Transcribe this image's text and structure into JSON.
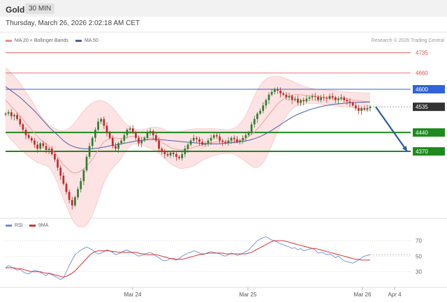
{
  "header": {
    "symbol": "Gold",
    "timeframe": "30 MIN"
  },
  "subheader": {
    "datetime": "Thursday, March 26, 2026 2:02:18 AM CET"
  },
  "legend": {
    "ma20_label": "MA 20 + Bollinger Bands",
    "ma50_label": "MA 50",
    "credit": "Research © 2026 Trading Central"
  },
  "rsi_legend": {
    "rsi_label": "RSI",
    "ma_label": "9MA"
  },
  "colors": {
    "up_candle": "#2e7d32",
    "down_candle": "#c62828",
    "bollinger_fill": "#fde3e3",
    "ma20": "#f0a0a0",
    "ma50": "#4a5fa8",
    "resistance": "#e04a4a",
    "pivot_blue": "#2f63d6",
    "support_green": "#1e8a1e",
    "last_price": "#333333",
    "arrow": "#2a5aa0",
    "rsi_line": "#6b8fd6",
    "rsi_ma": "#d83030"
  },
  "chart_data": [
    {
      "type": "candlestick",
      "title": "Gold 30 MIN",
      "x_ticks": [
        "Mar 24",
        "Mar 25",
        "Mar 26",
        "Apr 4"
      ],
      "ylim": [
        4130,
        4760
      ],
      "levels": [
        {
          "value": 4735,
          "label": "4735",
          "kind": "resistance"
        },
        {
          "value": 4660,
          "label": "4660",
          "kind": "resistance"
        },
        {
          "value": 4600,
          "label": "4600",
          "kind": "pivot"
        },
        {
          "value": 4535,
          "label": "4535",
          "kind": "last_price"
        },
        {
          "value": 4440,
          "label": "4440",
          "kind": "support"
        },
        {
          "value": 4370,
          "label": "4370",
          "kind": "support"
        }
      ],
      "projection": {
        "from": 4535,
        "to": 4370
      },
      "close": [
        4510,
        4515,
        4500,
        4505,
        4490,
        4470,
        4450,
        4430,
        4420,
        4410,
        4395,
        4380,
        4400,
        4390,
        4375,
        4380,
        4360,
        4340,
        4310,
        4280,
        4250,
        4220,
        4190,
        4170,
        4200,
        4230,
        4260,
        4300,
        4350,
        4390,
        4420,
        4450,
        4480,
        4490,
        4465,
        4440,
        4420,
        4390,
        4380,
        4400,
        4410,
        4430,
        4450,
        4455,
        4440,
        4420,
        4400,
        4410,
        4420,
        4440,
        4445,
        4430,
        4410,
        4380,
        4370,
        4360,
        4355,
        4365,
        4360,
        4350,
        4345,
        4360,
        4380,
        4395,
        4410,
        4420,
        4415,
        4405,
        4395,
        4400,
        4410,
        4420,
        4430,
        4425,
        4410,
        4405,
        4400,
        4410,
        4420,
        4415,
        4405,
        4410,
        4420,
        4430,
        4440,
        4470,
        4490,
        4510,
        4520,
        4540,
        4560,
        4580,
        4590,
        4600,
        4595,
        4585,
        4580,
        4570,
        4575,
        4560,
        4565,
        4550,
        4560,
        4555,
        4565,
        4570,
        4575,
        4572,
        4560,
        4570,
        4568,
        4565,
        4575,
        4570,
        4560,
        4565,
        4570,
        4560,
        4555,
        4550,
        4540,
        4530,
        4520,
        4530,
        4525,
        4530,
        4535
      ],
      "ma20": [
        4560,
        4548,
        4536,
        4525,
        4513,
        4500,
        4488,
        4475,
        4463,
        4450,
        4438,
        4425,
        4415,
        4405,
        4398,
        4390,
        4378,
        4365,
        4350,
        4335,
        4320,
        4310,
        4300,
        4292,
        4290,
        4292,
        4298,
        4305,
        4315,
        4328,
        4342,
        4358,
        4375,
        4392,
        4405,
        4412,
        4418,
        4420,
        4420,
        4418,
        4418,
        4420,
        4422,
        4425,
        4426,
        4425,
        4423,
        4422,
        4421,
        4420,
        4420,
        4418,
        4415,
        4410,
        4404,
        4397,
        4390,
        4384,
        4380,
        4378,
        4376,
        4376,
        4378,
        4380,
        4382,
        4385,
        4388,
        4392,
        4395,
        4398,
        4400,
        4402,
        4404,
        4405,
        4406,
        4406,
        4406,
        4406,
        4407,
        4408,
        4408,
        4410,
        4413,
        4418,
        4425,
        4433,
        4442,
        4453,
        4465,
        4478,
        4492,
        4506,
        4520,
        4533,
        4545,
        4555,
        4563,
        4570,
        4575,
        4578,
        4580,
        4580,
        4580,
        4578,
        4577,
        4576,
        4575,
        4574,
        4573,
        4572,
        4570,
        4569,
        4568,
        4567,
        4566,
        4565,
        4564,
        4563,
        4562,
        4561,
        4560,
        4558,
        4557,
        4556,
        4555,
        4554,
        4553
      ],
      "ma50": [
        4610,
        4602,
        4594,
        4586,
        4578,
        4570,
        4560,
        4550,
        4540,
        4530,
        4520,
        4508,
        4496,
        4484,
        4472,
        4460,
        4450,
        4440,
        4430,
        4420,
        4410,
        4402,
        4395,
        4390,
        4386,
        4383,
        4381,
        4380,
        4380,
        4380,
        4380,
        4381,
        4382,
        4384,
        4386,
        4388,
        4390,
        4392,
        4394,
        4396,
        4398,
        4400,
        4402,
        4404,
        4406,
        4408,
        4410,
        4411,
        4412,
        4413,
        4414,
        4414,
        4414,
        4414,
        4413,
        4412,
        4411,
        4410,
        4409,
        4408,
        4407,
        4406,
        4405,
        4404,
        4403,
        4402,
        4401,
        4400,
        4399,
        4398,
        4398,
        4398,
        4398,
        4398,
        4398,
        4399,
        4400,
        4401,
        4402,
        4403,
        4404,
        4405,
        4407,
        4409,
        4411,
        4414,
        4417,
        4421,
        4425,
        4430,
        4436,
        4442,
        4448,
        4455,
        4462,
        4469,
        4476,
        4483,
        4490,
        4496,
        4502,
        4507,
        4512,
        4516,
        4520,
        4524,
        4527,
        4530,
        4533,
        4536,
        4538,
        4540,
        4542,
        4544,
        4545,
        4546,
        4547,
        4548,
        4549,
        4550,
        4550,
        4551,
        4551,
        4552,
        4552,
        4553,
        4553
      ],
      "bb_upper": [
        4680,
        4670,
        4660,
        4648,
        4636,
        4622,
        4606,
        4590,
        4574,
        4558,
        4540,
        4522,
        4505,
        4490,
        4478,
        4468,
        4460,
        4455,
        4450,
        4447,
        4447,
        4450,
        4456,
        4465,
        4478,
        4492,
        4506,
        4520,
        4532,
        4542,
        4550,
        4555,
        4558,
        4558,
        4555,
        4550,
        4542,
        4532,
        4520,
        4506,
        4492,
        4478,
        4468,
        4460,
        4455,
        4452,
        4450,
        4450,
        4452,
        4455,
        4458,
        4460,
        4460,
        4458,
        4455,
        4450,
        4446,
        4444,
        4443,
        4443,
        4444,
        4446,
        4448,
        4450,
        4452,
        4453,
        4454,
        4454,
        4454,
        4454,
        4454,
        4454,
        4454,
        4453,
        4452,
        4451,
        4450,
        4450,
        4452,
        4456,
        4462,
        4472,
        4486,
        4504,
        4526,
        4550,
        4574,
        4596,
        4614,
        4628,
        4638,
        4644,
        4647,
        4648,
        4648,
        4646,
        4643,
        4639,
        4635,
        4630,
        4625,
        4620,
        4615,
        4611,
        4608,
        4605,
        4603,
        4601,
        4600,
        4599,
        4598,
        4597,
        4596,
        4595,
        4594,
        4593,
        4592,
        4591,
        4590,
        4589,
        4588,
        4588,
        4587,
        4587,
        4586,
        4586,
        4586
      ],
      "bb_lower": [
        4440,
        4426,
        4412,
        4402,
        4390,
        4378,
        4370,
        4360,
        4352,
        4342,
        4336,
        4328,
        4325,
        4320,
        4318,
        4312,
        4296,
        4275,
        4250,
        4223,
        4193,
        4170,
        4144,
        4119,
        4102,
        4092,
        4090,
        4090,
        4098,
        4114,
        4134,
        4161,
        4192,
        4226,
        4255,
        4274,
        4294,
        4308,
        4320,
        4330,
        4344,
        4362,
        4376,
        4390,
        4397,
        4398,
        4396,
        4394,
        4390,
        4385,
        4382,
        4376,
        4370,
        4362,
        4353,
        4344,
        4334,
        4324,
        4317,
        4313,
        4308,
        4306,
        4308,
        4310,
        4312,
        4317,
        4322,
        4330,
        4336,
        4342,
        4346,
        4350,
        4354,
        4357,
        4360,
        4361,
        4362,
        4362,
        4362,
        4360,
        4354,
        4348,
        4340,
        4332,
        4324,
        4316,
        4310,
        4310,
        4316,
        4328,
        4346,
        4368,
        4393,
        4418,
        4442,
        4464,
        4483,
        4501,
        4515,
        4526,
        4535,
        4540,
        4545,
        4545,
        4546,
        4547,
        4547,
        4547,
        4546,
        4545,
        4542,
        4541,
        4540,
        4539,
        4538,
        4537,
        4536,
        4535,
        4534,
        4533,
        4532,
        4528,
        4527,
        4525,
        4524,
        4522,
        4520
      ]
    },
    {
      "type": "line",
      "title": "RSI",
      "y_ticks": [
        30,
        50,
        70
      ],
      "ylim": [
        17,
        80
      ],
      "series": [
        {
          "name": "RSI",
          "values": [
            35,
            38,
            36,
            34,
            32,
            33,
            30,
            28,
            27,
            30,
            32,
            31,
            29,
            27,
            25,
            28,
            26,
            24,
            22,
            20,
            22,
            30,
            38,
            45,
            52,
            55,
            58,
            60,
            62,
            60,
            58,
            55,
            53,
            54,
            56,
            58,
            57,
            55,
            52,
            53,
            55,
            57,
            58,
            56,
            54,
            52,
            50,
            51,
            52,
            54,
            55,
            53,
            50,
            48,
            45,
            44,
            45,
            47,
            46,
            45,
            47,
            50,
            52,
            54,
            55,
            57,
            56,
            54,
            52,
            53,
            55,
            56,
            55,
            54,
            53,
            51,
            50,
            52,
            54,
            53,
            51,
            52,
            54,
            56,
            58,
            62,
            66,
            70,
            72,
            74,
            75,
            73,
            71,
            70,
            68,
            66,
            65,
            63,
            62,
            60,
            61,
            58,
            60,
            57,
            58,
            59,
            60,
            58,
            54,
            55,
            54,
            52,
            53,
            51,
            48,
            50,
            47,
            44,
            43,
            42,
            41,
            43,
            45,
            48,
            50,
            51,
            52
          ]
        },
        {
          "name": "9MA",
          "values": [
            35,
            35,
            35,
            35,
            34,
            34,
            33,
            32,
            31,
            30,
            30,
            30,
            30,
            29,
            28,
            28,
            27,
            26,
            25,
            24,
            23,
            24,
            26,
            28,
            31,
            35,
            39,
            43,
            47,
            51,
            54,
            56,
            57,
            57,
            57,
            57,
            57,
            56,
            56,
            55,
            55,
            55,
            55,
            55,
            55,
            55,
            54,
            53,
            53,
            52,
            52,
            52,
            52,
            51,
            50,
            49,
            48,
            47,
            47,
            46,
            46,
            46,
            47,
            48,
            49,
            50,
            51,
            52,
            53,
            53,
            54,
            54,
            54,
            54,
            54,
            54,
            53,
            53,
            53,
            53,
            53,
            53,
            53,
            53,
            54,
            55,
            57,
            59,
            61,
            63,
            65,
            67,
            69,
            70,
            70,
            70,
            70,
            69,
            68,
            67,
            66,
            65,
            64,
            63,
            62,
            61,
            60,
            60,
            59,
            58,
            57,
            56,
            55,
            54,
            53,
            52,
            51,
            50,
            49,
            48,
            47,
            46,
            46,
            45,
            45,
            45,
            45
          ]
        }
      ]
    }
  ]
}
